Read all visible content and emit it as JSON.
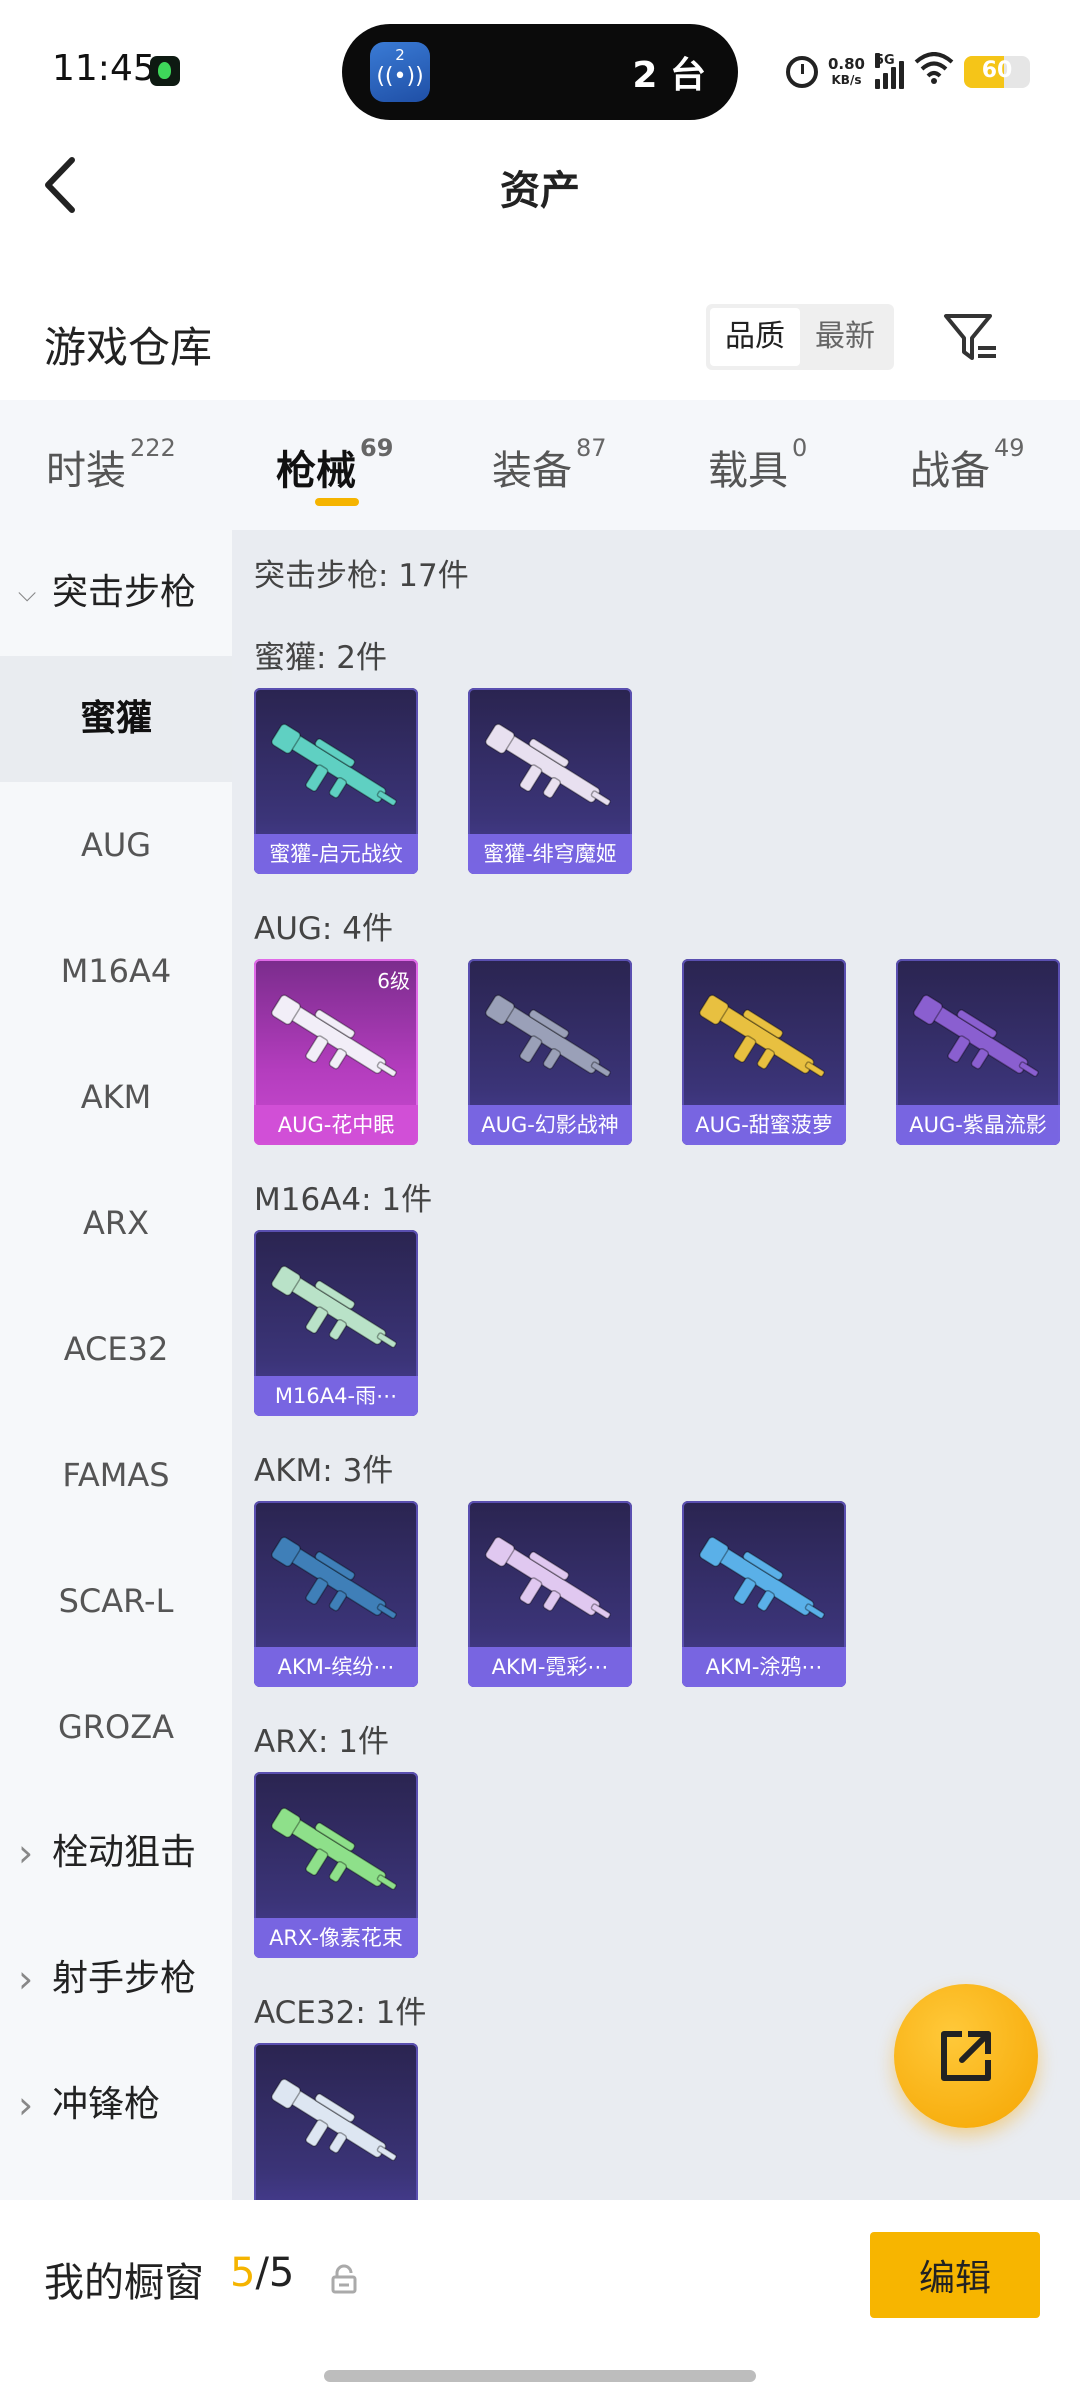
{
  "status_bar": {
    "time": "11:45",
    "island_icon_num": "2",
    "island_text": "2 台",
    "speed_value": "0.80",
    "speed_unit": "KB/s",
    "network": "5G",
    "battery": "60",
    "battery_level": 0.6
  },
  "header": {
    "title": "资产"
  },
  "section": {
    "title": "游戏仓库",
    "sort_options": [
      "品质",
      "最新"
    ],
    "active_sort": "品质"
  },
  "tabs": [
    {
      "label": "时装",
      "count": "222"
    },
    {
      "label": "枪械",
      "count": "69",
      "active": true
    },
    {
      "label": "装备",
      "count": "87"
    },
    {
      "label": "载具",
      "count": "0"
    },
    {
      "label": "战备",
      "count": "49"
    }
  ],
  "sidebar": {
    "items": [
      {
        "label": "突击步枪",
        "type": "category",
        "expanded": true
      },
      {
        "label": "蜜獾",
        "type": "sub",
        "selected": true
      },
      {
        "label": "AUG",
        "type": "sub"
      },
      {
        "label": "M16A4",
        "type": "sub"
      },
      {
        "label": "AKM",
        "type": "sub"
      },
      {
        "label": "ARX",
        "type": "sub"
      },
      {
        "label": "ACE32",
        "type": "sub"
      },
      {
        "label": "FAMAS",
        "type": "sub"
      },
      {
        "label": "SCAR-L",
        "type": "sub"
      },
      {
        "label": "GROZA",
        "type": "sub"
      },
      {
        "label": "栓动狙击",
        "type": "category"
      },
      {
        "label": "射手步枪",
        "type": "category"
      },
      {
        "label": "冲锋枪",
        "type": "category"
      }
    ]
  },
  "content": {
    "total": "突击步枪: 17件",
    "groups": [
      {
        "heading": "蜜獾: 2件",
        "items": [
          {
            "name": "蜜獾-启元战纹",
            "color": "#5fd0c2"
          },
          {
            "name": "蜜獾-绯穹魔姬",
            "color": "#e8e0f0"
          }
        ]
      },
      {
        "heading": "AUG: 4件",
        "items": [
          {
            "name": "AUG-花中眠",
            "color": "#f2eef8",
            "level": "6级",
            "rarity": "pink"
          },
          {
            "name": "AUG-幻影战神",
            "color": "#9aa0b8"
          },
          {
            "name": "AUG-甜蜜菠萝",
            "color": "#e8c040"
          },
          {
            "name": "AUG-紫晶流影",
            "color": "#8a5fd0"
          }
        ]
      },
      {
        "heading": "M16A4: 1件",
        "items": [
          {
            "name": "M16A4-雨⋯",
            "color": "#b9e2c8"
          }
        ]
      },
      {
        "heading": "AKM: 3件",
        "items": [
          {
            "name": "AKM-缤纷⋯",
            "color": "#3f7fb8"
          },
          {
            "name": "AKM-霓彩⋯",
            "color": "#e0c8f0"
          },
          {
            "name": "AKM-涂鸦⋯",
            "color": "#5ab0e8"
          }
        ]
      },
      {
        "heading": "ARX: 1件",
        "items": [
          {
            "name": "ARX-像素花束",
            "color": "#8ee08a"
          }
        ]
      },
      {
        "heading": "ACE32: 1件",
        "items": [
          {
            "name": "",
            "color": "#dde6f2"
          }
        ]
      }
    ]
  },
  "bottom_bar": {
    "label": "我的橱窗",
    "current": "5",
    "sep_total": "/5",
    "edit_label": "编辑"
  },
  "icons": {
    "back": "back-arrow-icon",
    "filter": "filter-icon",
    "share": "share-external-icon",
    "lock": "lock-icon"
  },
  "colors": {
    "accent": "#f5b400",
    "card_bg": "#3b3478",
    "card_label": "#7b67e6",
    "card_pink": "#c94ad0"
  }
}
